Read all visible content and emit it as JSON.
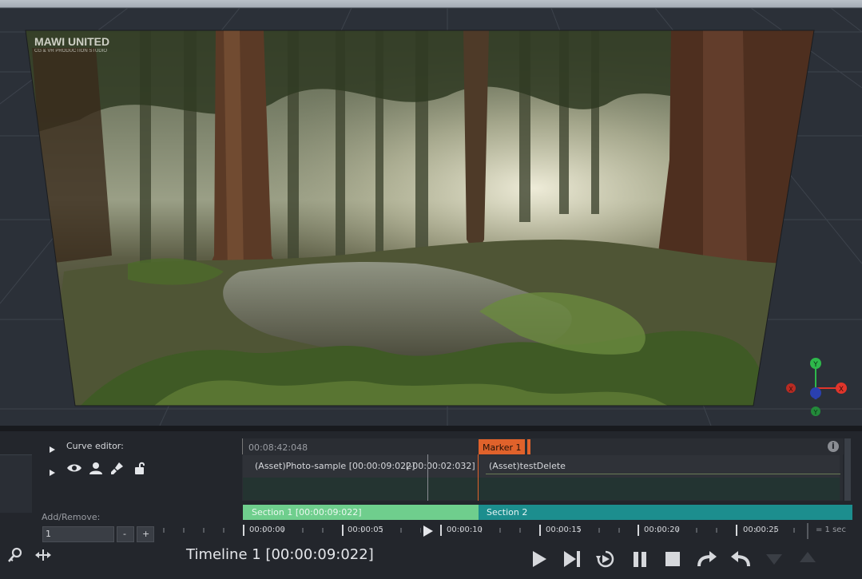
{
  "viewport": {
    "watermark": "MAWI UNITED",
    "watermark_sub": "CG & VR PRODUCTION STUDIO",
    "gizmo": {
      "x_label": "X",
      "y_label": "Y",
      "y_color": "#2eb84b",
      "x_color": "#e0352b",
      "z_color": "#2a40b0"
    }
  },
  "panel": {
    "curve_editor_label": "Curve editor:",
    "add_remove_label": "Add/Remove:",
    "count_value": "1",
    "minus_label": "-",
    "plus_label": "+"
  },
  "timeline": {
    "timecode": "00:08:42:048",
    "marker_label": "Marker 1",
    "info_icon": "i",
    "clips": [
      {
        "label": "(Asset)Photo-sample [00:00:09:022]",
        "offset": "[-00:00:02:032]"
      },
      {
        "label": "(Asset)testDelete"
      }
    ],
    "sections": [
      {
        "label": "Section 1 [00:00:09:022]",
        "color": "#6fce8d"
      },
      {
        "label": "Section 2",
        "color": "#1c8e8e"
      }
    ],
    "ruler_ticks": [
      "00:00:00",
      "00:00:05",
      "00:00:10",
      "00:00:15",
      "00:00:20",
      "00:00:25"
    ],
    "scale_label": "= 1 sec",
    "title": "Timeline 1 [00:00:09:022]"
  },
  "colors": {
    "accent_marker": "#e0622b",
    "playhead": "#e0622b"
  },
  "toolbar_icons": [
    "key-icon",
    "expand-horizontal-icon"
  ],
  "transport_icons": [
    "play-icon",
    "step-forward-icon",
    "loop-icon",
    "pause-icon",
    "stop-icon",
    "redo-icon",
    "undo-icon",
    "down-arrow-icon",
    "up-arrow-icon"
  ]
}
